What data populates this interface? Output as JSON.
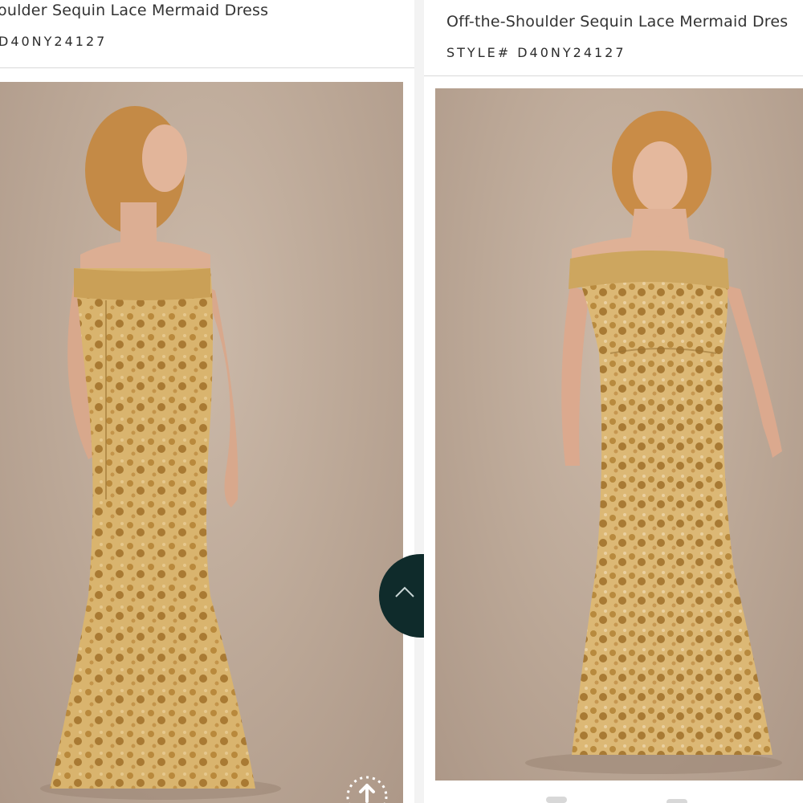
{
  "left": {
    "title": "oulder Sequin Lace Mermaid Dress",
    "style": "D40NY24127"
  },
  "right": {
    "title": "Off-the-Shoulder Sequin Lace Mermaid Dres",
    "style": "STYLE# D40NY24127"
  },
  "icons": {
    "scroll_up": "chevron-up-icon",
    "share": "upload-icon"
  },
  "colors": {
    "gown": "#c9a35e",
    "backdrop": "#bba796",
    "scroll_button": "#0f2b2b"
  }
}
